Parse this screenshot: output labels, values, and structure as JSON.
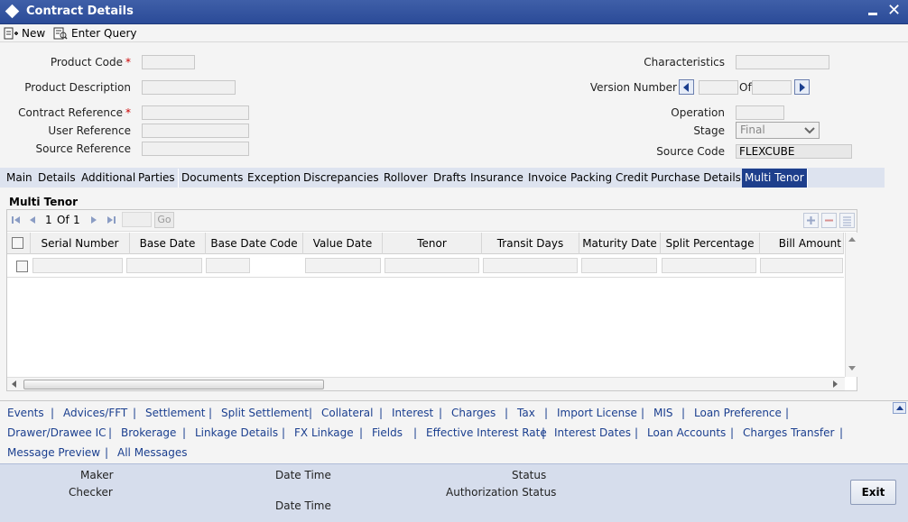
{
  "window": {
    "title": "Contract Details"
  },
  "toolbar": {
    "new_label": "New",
    "enter_query_label": "Enter Query"
  },
  "form": {
    "product_code": {
      "label": "Product Code",
      "value": ""
    },
    "product_description": {
      "label": "Product Description",
      "value": ""
    },
    "contract_reference": {
      "label": "Contract Reference",
      "value": ""
    },
    "user_reference": {
      "label": "User Reference",
      "value": ""
    },
    "source_reference": {
      "label": "Source Reference",
      "value": ""
    },
    "characteristics": {
      "label": "Characteristics",
      "value": ""
    },
    "version_number": {
      "label": "Version Number",
      "of_label": "Of",
      "value": "",
      "total": ""
    },
    "operation": {
      "label": "Operation",
      "value": ""
    },
    "stage": {
      "label": "Stage",
      "value": "Final"
    },
    "source_code": {
      "label": "Source Code",
      "value": "FLEXCUBE"
    },
    "required_marker": "*"
  },
  "tabs": [
    "Main",
    "Details",
    "Additional",
    "Parties",
    "Documents",
    "Exception",
    "Discrepancies",
    "Rollover",
    "Drafts",
    "Insurance",
    "Invoice",
    "Packing Credit",
    "Purchase Details",
    "Multi Tenor"
  ],
  "active_tab": "Multi Tenor",
  "multi_tenor": {
    "title": "Multi Tenor",
    "pager": {
      "current": "1",
      "of_label": "Of",
      "total": "1",
      "go_label": "Go"
    },
    "columns": [
      "Serial Number",
      "Base Date",
      "Base Date Code",
      "Value Date",
      "Tenor",
      "Transit Days",
      "Maturity Date",
      "Split Percentage",
      "Bill Amount"
    ]
  },
  "links": {
    "row1": [
      "Events",
      "Advices/FFT",
      "Settlement",
      "Split Settlement",
      "Collateral",
      "Interest",
      "Charges",
      "Tax",
      "Import License",
      "MIS",
      "Loan Preference"
    ],
    "row2": [
      "Drawer/Drawee IC",
      "Brokerage",
      "Linkage Details",
      "FX Linkage",
      "Fields",
      "Effective Interest Rate",
      "Interest Dates",
      "Loan Accounts",
      "Charges Transfer"
    ],
    "row3": [
      "Message Preview",
      "All Messages"
    ],
    "separator": "|"
  },
  "footer": {
    "maker": "Maker",
    "checker": "Checker",
    "date_time": "Date Time",
    "status": "Status",
    "authorization_status": "Authorization Status",
    "exit_label": "Exit"
  }
}
